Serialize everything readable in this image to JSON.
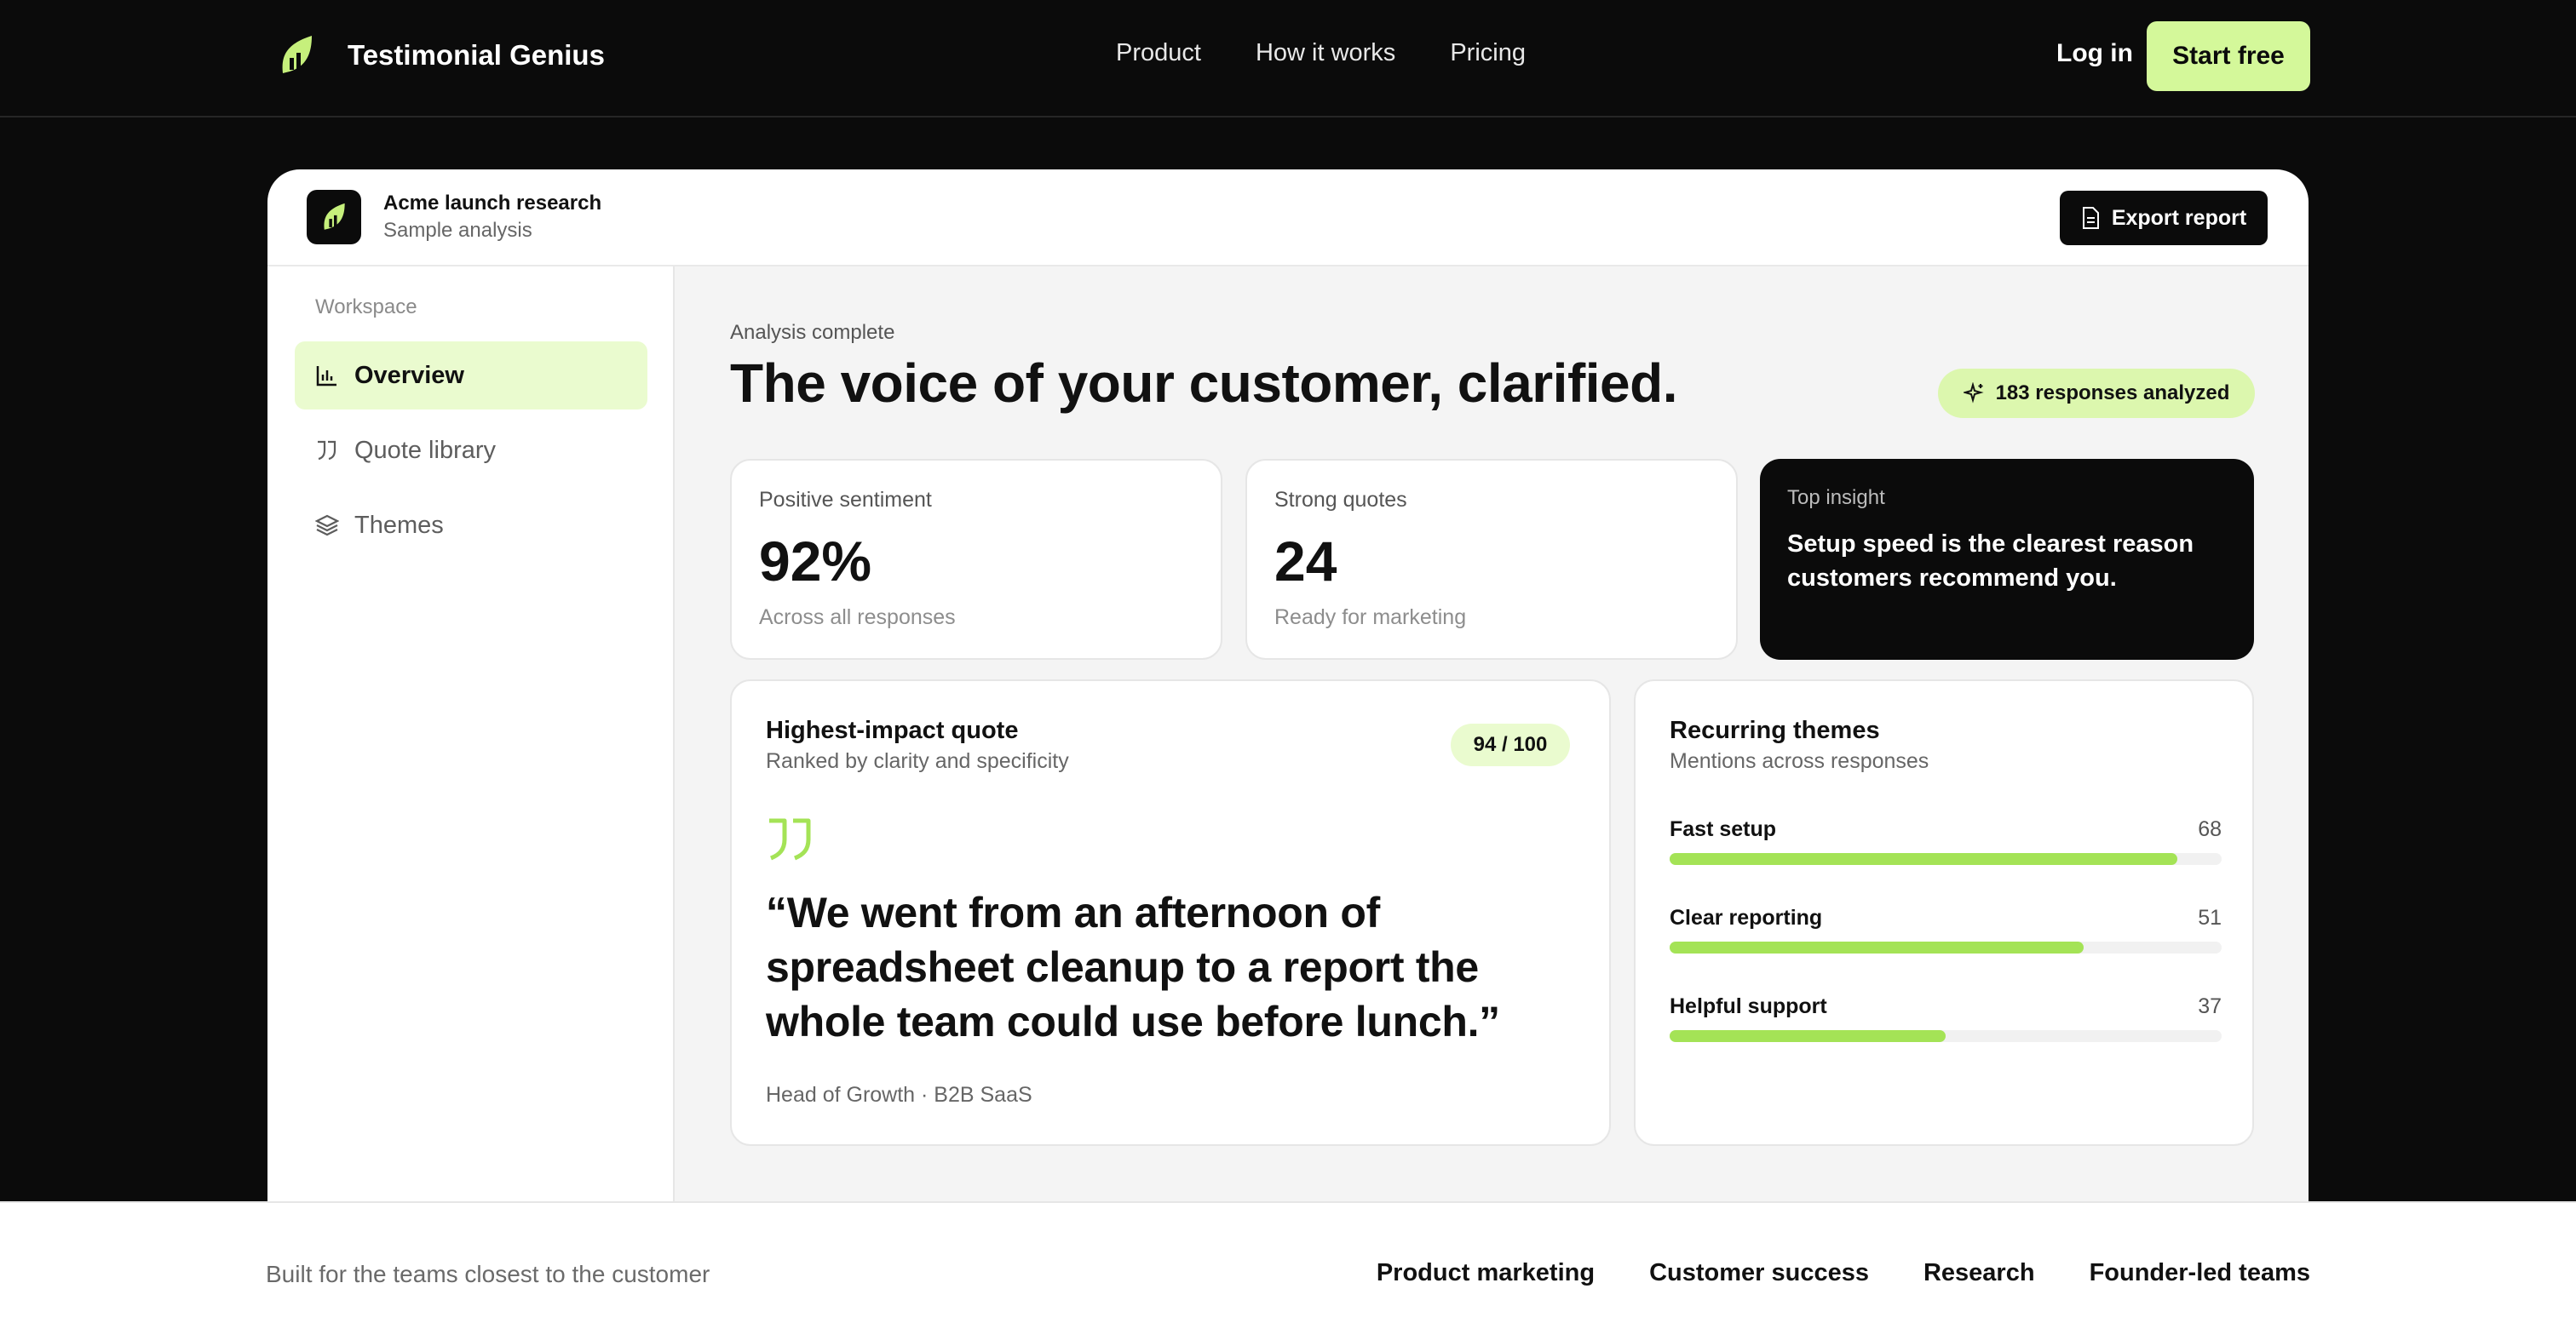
{
  "nav": {
    "brand": "Testimonial Genius",
    "links": [
      "Product",
      "How it works",
      "Pricing"
    ],
    "login": "Log in",
    "cta": "Start free"
  },
  "app": {
    "project_title": "Acme launch research",
    "project_sub": "Sample analysis",
    "export": "Export report",
    "sidebar": {
      "section": "Workspace",
      "items": [
        {
          "label": "Overview",
          "icon": "bar-chart-icon",
          "active": true
        },
        {
          "label": "Quote library",
          "icon": "quote-icon",
          "active": false
        },
        {
          "label": "Themes",
          "icon": "layers-icon",
          "active": false
        }
      ]
    },
    "main": {
      "status": "Analysis complete",
      "headline": "The voice of your customer, clarified.",
      "responses": "183 responses analyzed",
      "stats": [
        {
          "label": "Positive sentiment",
          "value": "92%",
          "sub": "Across all responses"
        },
        {
          "label": "Strong quotes",
          "value": "24",
          "sub": "Ready for marketing"
        }
      ],
      "insight": {
        "label": "Top insight",
        "text": "Setup speed is the clearest reason customers recommend you."
      },
      "quote": {
        "title": "Highest-impact quote",
        "sub": "Ranked by clarity and specificity",
        "score": "94 / 100",
        "text": "“We went from an afternoon of spreadsheet cleanup to a report the whole team could use before lunch.”",
        "attribution": "Head of Growth · B2B SaaS"
      },
      "themes": {
        "title": "Recurring themes",
        "sub": "Mentions across responses",
        "items": [
          {
            "name": "Fast setup",
            "count": "68",
            "fraction": 0.92
          },
          {
            "name": "Clear reporting",
            "count": "51",
            "fraction": 0.75
          },
          {
            "name": "Helpful support",
            "count": "37",
            "fraction": 0.5
          }
        ]
      }
    }
  },
  "band": {
    "text": "Built for the teams closest to the customer",
    "links": [
      "Product marketing",
      "Customer success",
      "Research",
      "Founder-led teams"
    ]
  },
  "colors": {
    "accent": "#d4f89a",
    "bar_fill": "#a4e356",
    "background": "#0b0b0b"
  }
}
